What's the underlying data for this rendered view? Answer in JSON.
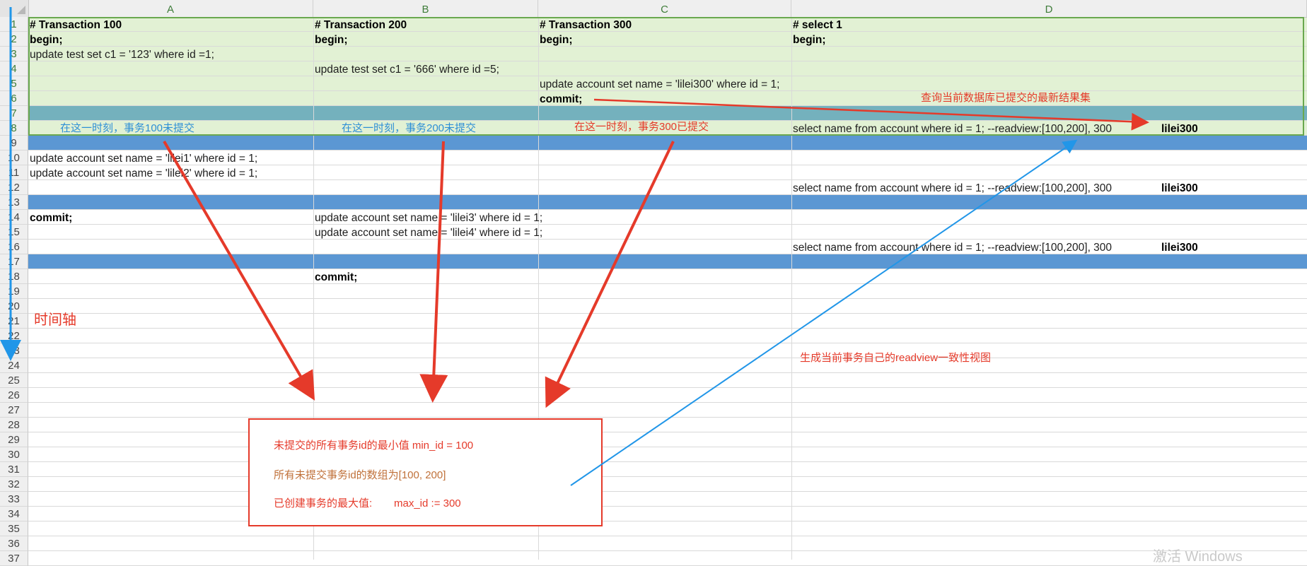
{
  "columns": [
    "A",
    "B",
    "C",
    "D"
  ],
  "rows": [
    "1",
    "2",
    "3",
    "4",
    "5",
    "6",
    "7",
    "8",
    "9",
    "10",
    "11",
    "12",
    "13",
    "14",
    "15",
    "16",
    "17",
    "18",
    "19",
    "20",
    "21",
    "22",
    "23",
    "24",
    "25",
    "26",
    "27",
    "28",
    "29",
    "30",
    "31",
    "32",
    "33",
    "34",
    "35",
    "36",
    "37"
  ],
  "cells": {
    "a1": "# Transaction 100",
    "b1": "# Transaction 200",
    "c1": "# Transaction 300",
    "d1": "# select 1",
    "a2": "begin;",
    "b2": "begin;",
    "c2": "begin;",
    "d2": "begin;",
    "a3": "update test set c1 = '123' where id =1;",
    "b4": "update test set c1 = '666' where id =5;",
    "c5": "update account set name = 'lilei300' where id = 1;",
    "c6": "commit;",
    "a8": "在这一时刻，事务100未提交",
    "b8": "在这一时刻，事务200未提交",
    "c8": "在这一时刻，事务300已提交",
    "d8": "select name from account where id = 1;   --readview:[100,200], 300",
    "e8": "lilei300",
    "a10": "update account set name = 'lilei1' where id = 1;",
    "a11": "update account set name = 'lilei2' where id = 1;",
    "d12": "select name from account where id = 1;   --readview:[100,200], 300",
    "e12": "lilei300",
    "a14": "commit;",
    "b14": "update account set name = 'lilei3' where id = 1;",
    "b15": "update account set name = 'lilei4' where id = 1;",
    "d16": "select name from account where id = 1;   --readview:[100,200], 300",
    "e16": "lilei300",
    "b18": "commit;"
  },
  "annotations": {
    "query_latest": "查询当前数据库已提交的最新结果集",
    "timeline": "时间轴",
    "generate_readview": "生成当前事务自己的readview一致性视图",
    "min_id": "未提交的所有事务id的最小值 min_id = 100",
    "uncommitted_array": "所有未提交事务id的数组为[100, 200]",
    "max_label": "已创建事务的最大值:",
    "max_value": "max_id := 300"
  },
  "watermark": "激活 Windows",
  "colors": {
    "highlight_green": "#e2f1d4",
    "teal_band": "#74b1bd",
    "blue_band": "#5b97d3",
    "arrow_red": "#e53a2a",
    "arrow_blue": "#2196e8"
  }
}
